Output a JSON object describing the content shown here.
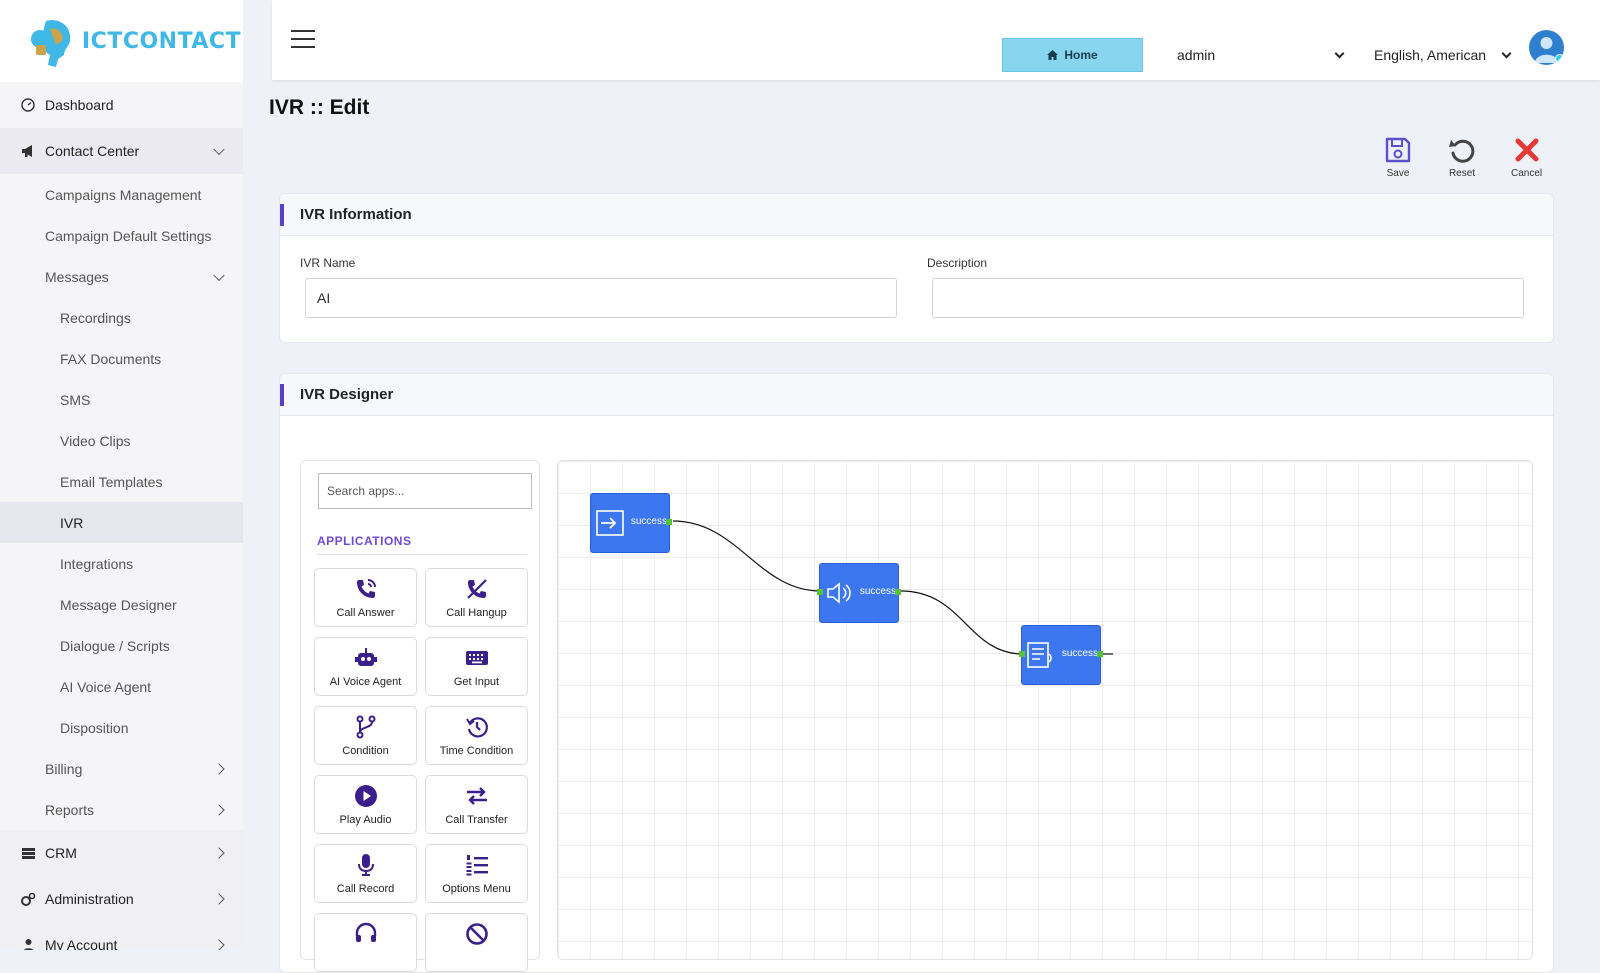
{
  "brand": {
    "logo_text": "ICTCONTACT"
  },
  "sidebar": {
    "dashboard": "Dashboard",
    "contact_center": "Contact Center",
    "campaigns_management": "Campaigns Management",
    "campaign_default_settings": "Campaign Default Settings",
    "messages": "Messages",
    "message_items": [
      "Recordings",
      "FAX Documents",
      "SMS",
      "Video Clips",
      "Email Templates",
      "IVR",
      "Integrations",
      "Message Designer",
      "Dialogue / Scripts",
      "AI Voice Agent",
      "Disposition"
    ],
    "billing": "Billing",
    "reports": "Reports",
    "crm": "CRM",
    "administration": "Administration",
    "my_account": "My Account"
  },
  "topbar": {
    "home_label": "Home",
    "user_select": "admin",
    "language_select": "English, American"
  },
  "page": {
    "title": "IVR :: Edit"
  },
  "actions": {
    "save": "Save",
    "reset": "Reset",
    "cancel": "Cancel"
  },
  "ivr_info": {
    "heading": "IVR Information",
    "name_label": "IVR Name",
    "name_value": "AI",
    "description_label": "Description",
    "description_value": ""
  },
  "designer": {
    "heading": "IVR Designer",
    "search_placeholder": "Search apps...",
    "applications_heading": "APPLICATIONS",
    "apps": [
      {
        "label": "Call Answer",
        "icon": "phone-answer-icon"
      },
      {
        "label": "Call Hangup",
        "icon": "phone-hangup-icon"
      },
      {
        "label": "AI Voice Agent",
        "icon": "robot-icon"
      },
      {
        "label": "Get Input",
        "icon": "keyboard-icon"
      },
      {
        "label": "Condition",
        "icon": "branch-icon"
      },
      {
        "label": "Time Condition",
        "icon": "clock-history-icon"
      },
      {
        "label": "Play Audio",
        "icon": "play-circle-icon"
      },
      {
        "label": "Call Transfer",
        "icon": "transfer-arrows-icon"
      },
      {
        "label": "Call Record",
        "icon": "microphone-icon"
      },
      {
        "label": "Options Menu",
        "icon": "numbered-list-icon"
      }
    ],
    "nodes": [
      {
        "label": "success",
        "icon": "start-icon"
      },
      {
        "label": "success",
        "icon": "speaker-icon"
      },
      {
        "label": "success",
        "icon": "menu-list-icon"
      }
    ]
  },
  "colors": {
    "accent": "#5b3fc4",
    "node_blue": "#3c77f0",
    "home_btn": "#87d5ef"
  }
}
